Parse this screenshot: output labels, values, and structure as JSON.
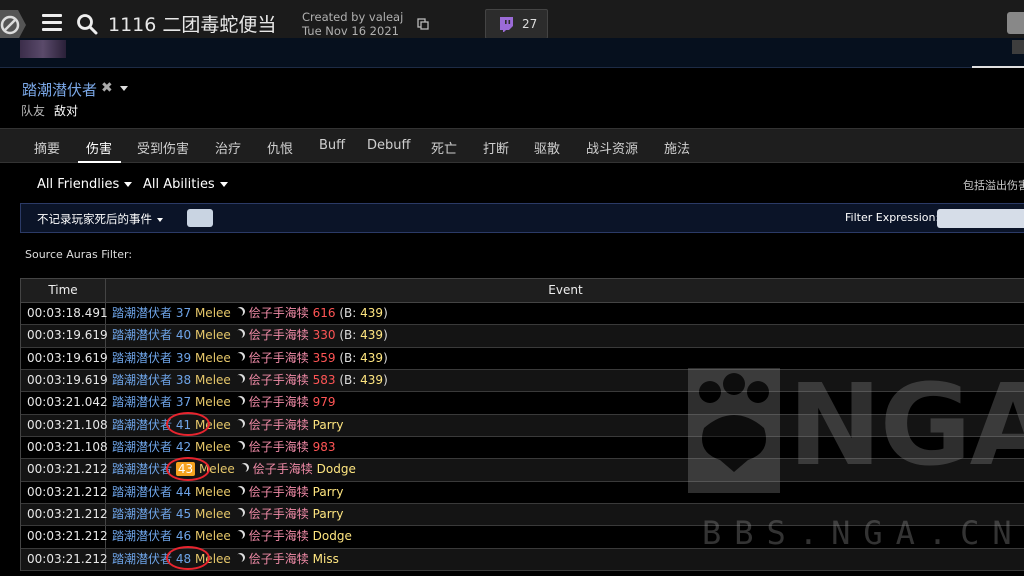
{
  "topbar": {
    "title": "1116 二团毒蛇便当",
    "created_by": "Created by valeaj",
    "created_date": "Tue Nov 16 2021",
    "twitch_count": "27"
  },
  "actor": {
    "name": "踏潮潜伏者",
    "close_glyph": "✖",
    "filters": [
      "队友",
      "敌对"
    ]
  },
  "tabs": [
    "摘要",
    "伤害",
    "受到伤害",
    "治疗",
    "仇恨",
    "Buff",
    "Debuff",
    "死亡",
    "打断",
    "驱散",
    "战斗资源",
    "施法"
  ],
  "active_tab": "伤害",
  "filters": {
    "friendlies": "All Friendlies",
    "abilities": "All Abilities",
    "overkill": "包括溢出伤害",
    "death_events": "不记录玩家死后的事件",
    "filter_expression_label": "Filter Expression:",
    "filter_expression_value": "",
    "source_auras_label": "Source Auras Filter:"
  },
  "table": {
    "headers": {
      "time": "Time",
      "event": "Event"
    },
    "rows": [
      {
        "time": "00:03:18.491",
        "source": "踏潮潜伏者",
        "num": "37",
        "ability": "Melee",
        "target": "侩子手海犊",
        "amount": "616",
        "blocked": "439",
        "result": ""
      },
      {
        "time": "00:03:19.619",
        "source": "踏潮潜伏者",
        "num": "40",
        "ability": "Melee",
        "target": "侩子手海犊",
        "amount": "330",
        "blocked": "439",
        "result": ""
      },
      {
        "time": "00:03:19.619",
        "source": "踏潮潜伏者",
        "num": "39",
        "ability": "Melee",
        "target": "侩子手海犊",
        "amount": "359",
        "blocked": "439",
        "result": ""
      },
      {
        "time": "00:03:19.619",
        "source": "踏潮潜伏者",
        "num": "38",
        "ability": "Melee",
        "target": "侩子手海犊",
        "amount": "583",
        "blocked": "439",
        "result": ""
      },
      {
        "time": "00:03:21.042",
        "source": "踏潮潜伏者",
        "num": "37",
        "ability": "Melee",
        "target": "侩子手海犊",
        "amount": "979",
        "blocked": "",
        "result": ""
      },
      {
        "time": "00:03:21.108",
        "source": "踏潮潜伏者",
        "num": "41",
        "ability": "Melee",
        "target": "侩子手海犊",
        "amount": "",
        "blocked": "",
        "result": "Parry"
      },
      {
        "time": "00:03:21.108",
        "source": "踏潮潜伏者",
        "num": "42",
        "ability": "Melee",
        "target": "侩子手海犊",
        "amount": "983",
        "blocked": "",
        "result": ""
      },
      {
        "time": "00:03:21.212",
        "source": "踏潮潜伏者",
        "num": "43",
        "ability": "Melee",
        "target": "侩子手海犊",
        "amount": "",
        "blocked": "",
        "result": "Dodge",
        "highlight": true
      },
      {
        "time": "00:03:21.212",
        "source": "踏潮潜伏者",
        "num": "44",
        "ability": "Melee",
        "target": "侩子手海犊",
        "amount": "",
        "blocked": "",
        "result": "Parry"
      },
      {
        "time": "00:03:21.212",
        "source": "踏潮潜伏者",
        "num": "45",
        "ability": "Melee",
        "target": "侩子手海犊",
        "amount": "",
        "blocked": "",
        "result": "Parry"
      },
      {
        "time": "00:03:21.212",
        "source": "踏潮潜伏者",
        "num": "46",
        "ability": "Melee",
        "target": "侩子手海犊",
        "amount": "",
        "blocked": "",
        "result": "Dodge"
      },
      {
        "time": "00:03:21.212",
        "source": "踏潮潜伏者",
        "num": "48",
        "ability": "Melee",
        "target": "侩子手海犊",
        "amount": "",
        "blocked": "",
        "result": "Miss"
      }
    ]
  },
  "watermark": {
    "logo": "NGA",
    "url": "BBS.NGA.CN"
  },
  "colors": {
    "source": "#6ea4e8",
    "ability": "#e6c76a",
    "target": "#f08ba7",
    "amount": "#ff5555",
    "highlight": "#f5a21f",
    "annotation_ring": "#e8242e"
  }
}
